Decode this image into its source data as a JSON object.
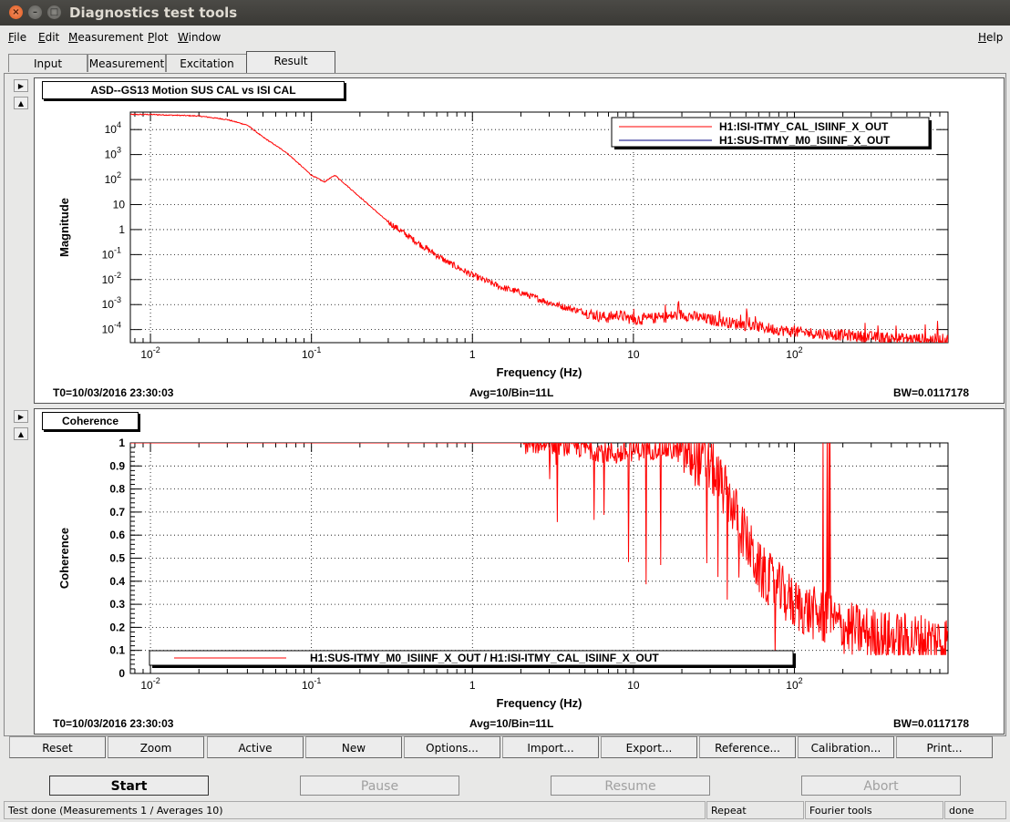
{
  "window": {
    "title": "Diagnostics test tools"
  },
  "menu": {
    "file": "File",
    "edit": "Edit",
    "measurement": "Measurement",
    "plot": "Plot",
    "window": "Window",
    "help": "Help"
  },
  "tabs": {
    "input": "Input",
    "measurement": "Measurement",
    "excitation": "Excitation",
    "result": "Result"
  },
  "plot1": {
    "title": "ASD--GS13 Motion SUS CAL vs ISI CAL",
    "t0": "T0=10/03/2016 23:30:03",
    "avg": "Avg=10/Bin=11L",
    "bw": "BW=0.0117178"
  },
  "plot2": {
    "title": "Coherence",
    "t0": "T0=10/03/2016 23:30:03",
    "avg": "Avg=10/Bin=11L",
    "bw": "BW=0.0117178"
  },
  "chart_data": [
    {
      "type": "line",
      "xlabel": "Frequency (Hz)",
      "ylabel": "Magnitude",
      "x_scale": "log",
      "y_scale": "log",
      "xlim": [
        0.0075,
        900
      ],
      "ylim": [
        3e-05,
        50000
      ],
      "grid": true,
      "legend_position": "top-right",
      "x_ticks": [
        {
          "v": 0.01,
          "b": "10",
          "e": "-2"
        },
        {
          "v": 0.1,
          "b": "10",
          "e": "-1"
        },
        {
          "v": 1,
          "b": "1",
          "e": ""
        },
        {
          "v": 10,
          "b": "10",
          "e": ""
        },
        {
          "v": 100,
          "b": "10",
          "e": "2"
        }
      ],
      "y_ticks": [
        {
          "v": 10000,
          "b": "10",
          "e": "4"
        },
        {
          "v": 1000,
          "b": "10",
          "e": "3"
        },
        {
          "v": 100,
          "b": "10",
          "e": "2"
        },
        {
          "v": 10,
          "b": "10",
          "e": ""
        },
        {
          "v": 1,
          "b": "1",
          "e": ""
        },
        {
          "v": 0.1,
          "b": "10",
          "e": "-1"
        },
        {
          "v": 0.01,
          "b": "10",
          "e": "-2"
        },
        {
          "v": 0.001,
          "b": "10",
          "e": "-3"
        },
        {
          "v": 0.0001,
          "b": "10",
          "e": "-4"
        }
      ],
      "series": [
        {
          "name": "H1:ISI-ITMY_CAL_ISIINF_X_OUT",
          "color": "#ff0000",
          "points": [
            [
              0.0075,
              40000
            ],
            [
              0.01,
              40000
            ],
            [
              0.02,
              35000
            ],
            [
              0.03,
              25000
            ],
            [
              0.04,
              15000
            ],
            [
              0.05,
              5000
            ],
            [
              0.07,
              1200
            ],
            [
              0.1,
              150
            ],
            [
              0.12,
              80
            ],
            [
              0.14,
              150
            ],
            [
              0.2,
              20
            ],
            [
              0.3,
              2
            ],
            [
              0.5,
              0.2
            ],
            [
              0.7,
              0.05
            ],
            [
              1,
              0.015
            ],
            [
              1.5,
              0.005
            ],
            [
              2,
              0.003
            ],
            [
              3,
              0.0012
            ],
            [
              4,
              0.0007
            ],
            [
              5,
              0.0005
            ],
            [
              6,
              0.00035
            ],
            [
              7,
              0.0003
            ],
            [
              8,
              0.0004
            ],
            [
              10,
              0.00025
            ],
            [
              15,
              0.0003
            ],
            [
              20,
              0.0004
            ],
            [
              30,
              0.00025
            ],
            [
              50,
              0.00015
            ],
            [
              100,
              8e-05
            ],
            [
              200,
              6e-05
            ],
            [
              400,
              4.5e-05
            ],
            [
              900,
              4e-05
            ]
          ]
        },
        {
          "name": "H1:SUS-ITMY_M0_ISIINF_X_OUT",
          "color": "#000080",
          "points": []
        }
      ]
    },
    {
      "type": "line",
      "xlabel": "Frequency (Hz)",
      "ylabel": "Coherence",
      "x_scale": "log",
      "y_scale": "linear",
      "xlim": [
        0.0075,
        900
      ],
      "ylim": [
        0,
        1
      ],
      "grid": true,
      "legend_position": "bottom-center",
      "y_ticks": [
        0,
        0.1,
        0.2,
        0.3,
        0.4,
        0.5,
        0.6,
        0.7,
        0.8,
        0.9,
        1
      ],
      "series": [
        {
          "name": "H1:SUS-ITMY_M0_ISIINF_X_OUT / H1:ISI-ITMY_CAL_ISIINF_X_OUT",
          "color": "#ff0000",
          "points": [
            [
              0.0075,
              1
            ],
            [
              3,
              1
            ],
            [
              5,
              0.98
            ],
            [
              8,
              0.95
            ],
            [
              10,
              0.97
            ],
            [
              15,
              0.98
            ],
            [
              20,
              0.96
            ],
            [
              30,
              0.9
            ],
            [
              40,
              0.75
            ],
            [
              60,
              0.45
            ],
            [
              100,
              0.3
            ],
            [
              200,
              0.2
            ],
            [
              400,
              0.15
            ],
            [
              900,
              0.14
            ]
          ]
        }
      ]
    }
  ],
  "controls": {
    "reset": "Reset",
    "zoom": "Zoom",
    "active": "Active",
    "new": "New",
    "options": "Options...",
    "import": "Import...",
    "export": "Export...",
    "reference": "Reference...",
    "calibration": "Calibration...",
    "print": "Print..."
  },
  "actions": {
    "start": "Start",
    "pause": "Pause",
    "resume": "Resume",
    "abort": "Abort"
  },
  "status": {
    "message": "Test done (Measurements 1 / Averages 10)",
    "repeat": "Repeat",
    "fourier": "Fourier tools",
    "state": "done"
  }
}
